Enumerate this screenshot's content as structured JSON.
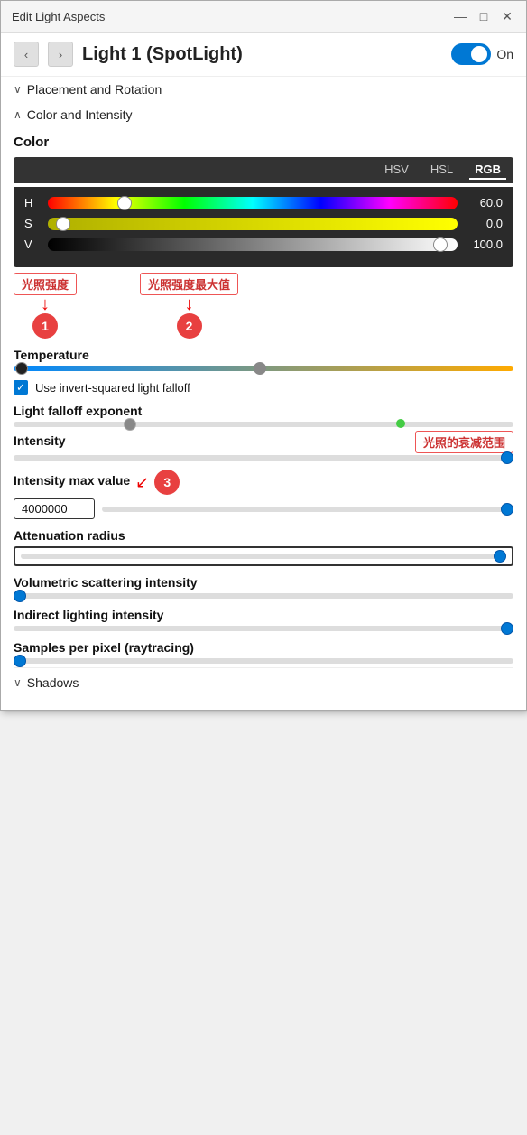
{
  "window": {
    "title": "Edit Light Aspects",
    "controls": {
      "minimize": "—",
      "maximize": "□",
      "close": "✕"
    }
  },
  "header": {
    "nav_prev": "‹",
    "nav_next": "›",
    "light_name": "Light 1 (SpotLight)",
    "toggle_state": "On"
  },
  "sections": {
    "placement": "Placement and Rotation",
    "color_intensity": "Color and Intensity"
  },
  "color": {
    "title": "Color",
    "tabs": [
      "HSV",
      "HSL",
      "RGB"
    ],
    "active_tab": "HSV",
    "h_label": "H",
    "h_value": "60.0",
    "h_thumb_pct": 17,
    "s_label": "S",
    "s_value": "0.0",
    "s_thumb_pct": 2,
    "v_label": "V",
    "v_value": "100.0",
    "v_thumb_pct": 96
  },
  "annotations": {
    "guangzhao_qiangdu": "光照强度",
    "guangzhao_zuida": "光照强度最大值",
    "shuaijian": "光照的衰减范围",
    "num1": "1",
    "num2": "2",
    "num3": "3"
  },
  "temperature": {
    "label": "Temperature"
  },
  "invert_checkbox": {
    "label": "Use invert-squared light falloff",
    "checked": true
  },
  "falloff": {
    "label": "Light falloff exponent"
  },
  "intensity": {
    "label": "Intensity"
  },
  "intensity_max": {
    "label": "Intensity max value",
    "value": "4000000"
  },
  "attenuation": {
    "label": "Attenuation radius"
  },
  "volumetric": {
    "label": "Volumetric scattering intensity"
  },
  "indirect": {
    "label": "Indirect lighting intensity"
  },
  "samples": {
    "label": "Samples per pixel (raytracing)"
  },
  "shadows": {
    "label": "Shadows"
  }
}
